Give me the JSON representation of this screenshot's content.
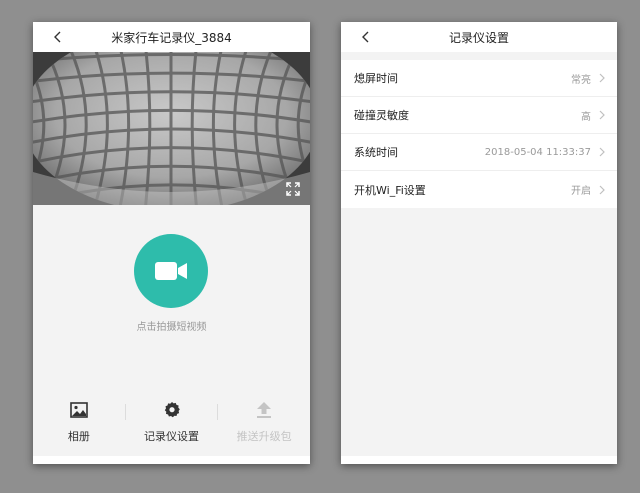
{
  "left_screen": {
    "title": "米家行车记录仪_3884",
    "record_hint": "点击拍摄短视频",
    "bottom_nav": [
      {
        "label": "相册",
        "icon": "image-icon",
        "enabled": true
      },
      {
        "label": "记录仪设置",
        "icon": "gear-icon",
        "enabled": true
      },
      {
        "label": "推送升级包",
        "icon": "upload-icon",
        "enabled": false
      }
    ]
  },
  "right_screen": {
    "title": "记录仪设置",
    "settings": [
      {
        "label": "熄屏时间",
        "value": "常亮"
      },
      {
        "label": "碰撞灵敏度",
        "value": "高"
      },
      {
        "label": "系统时间",
        "value": "2018-05-04 11:33:37"
      },
      {
        "label": "开机Wi_Fi设置",
        "value": "开启"
      }
    ]
  },
  "colors": {
    "accent": "#2ebcab",
    "background": "#8f8f8f",
    "screen_bg": "#f3f3f3"
  }
}
